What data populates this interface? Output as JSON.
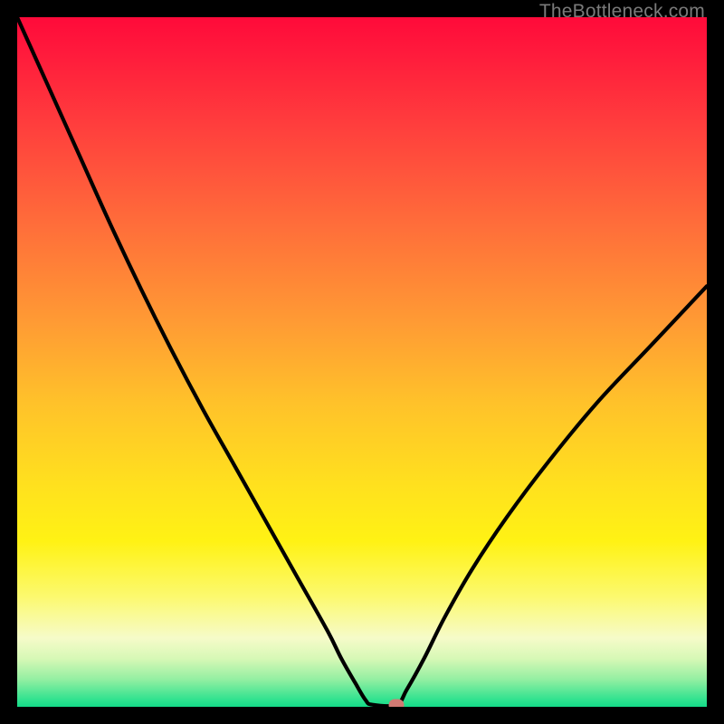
{
  "watermark": "TheBottleneck.com",
  "colors": {
    "frame": "#000000",
    "curve": "#000000",
    "marker": "#d17a73"
  },
  "chart_data": {
    "type": "line",
    "title": "",
    "xlabel": "",
    "ylabel": "",
    "xlim": [
      0,
      100
    ],
    "ylim": [
      0,
      100
    ],
    "series": [
      {
        "name": "left-branch",
        "x": [
          0.0,
          4.5,
          9.0,
          13.5,
          18.0,
          22.5,
          27.0,
          31.5,
          36.0,
          40.5,
          45.0,
          47.0,
          49.0,
          50.5,
          51.5
        ],
        "y": [
          100.0,
          90.0,
          80.0,
          70.0,
          60.5,
          51.5,
          43.0,
          35.0,
          27.0,
          19.0,
          11.0,
          7.0,
          3.5,
          1.0,
          0.3
        ]
      },
      {
        "name": "flat-bottom",
        "x": [
          51.5,
          55.0
        ],
        "y": [
          0.3,
          0.3
        ]
      },
      {
        "name": "right-branch",
        "x": [
          55.0,
          56.5,
          59.0,
          62.0,
          66.0,
          71.0,
          77.0,
          84.0,
          92.0,
          100.0
        ],
        "y": [
          0.3,
          2.5,
          7.0,
          13.0,
          20.0,
          27.5,
          35.5,
          44.0,
          52.5,
          61.0
        ]
      }
    ],
    "marker": {
      "x": 55.0,
      "y": 0.3
    },
    "background_gradient": {
      "stops": [
        {
          "pos": 0.0,
          "color": "#ff0a3a"
        },
        {
          "pos": 0.3,
          "color": "#ff6d3a"
        },
        {
          "pos": 0.56,
          "color": "#ffc22a"
        },
        {
          "pos": 0.76,
          "color": "#fff214"
        },
        {
          "pos": 0.9,
          "color": "#f6fbc9"
        },
        {
          "pos": 1.0,
          "color": "#14db88"
        }
      ]
    }
  }
}
